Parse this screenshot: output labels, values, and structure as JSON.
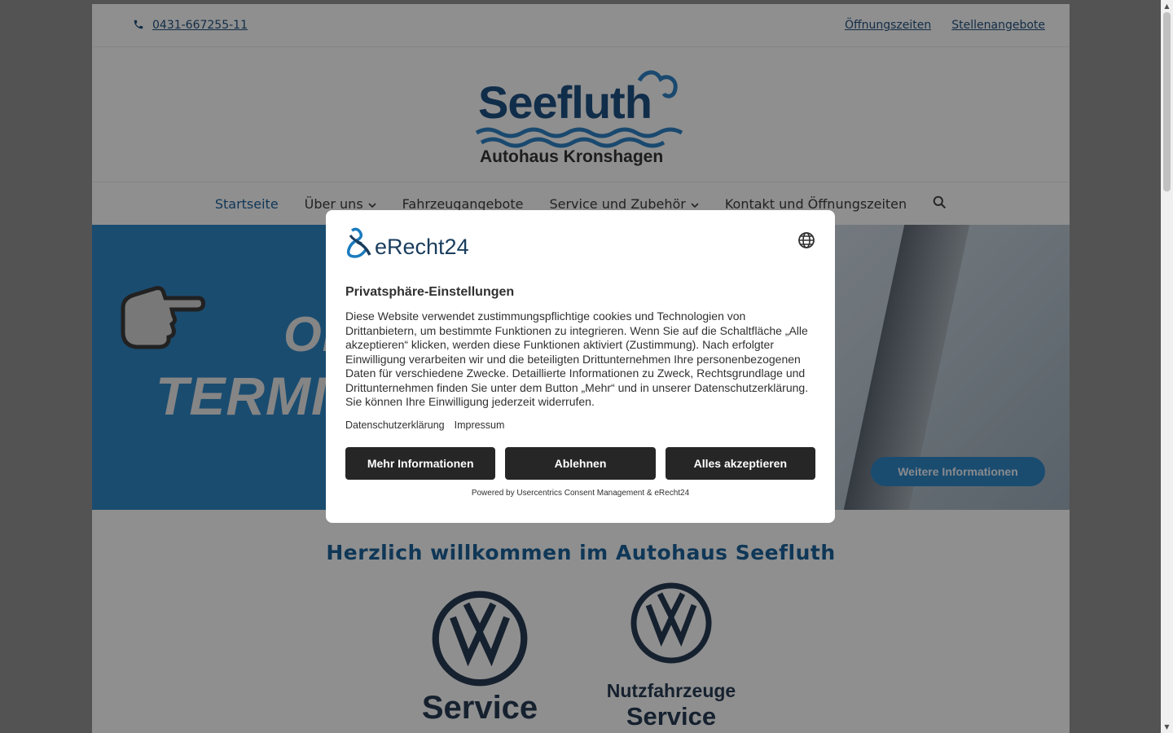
{
  "topbar": {
    "phone": "0431-667255-11",
    "links": [
      "Öffnungszeiten",
      "Stellenangebote"
    ]
  },
  "logo": {
    "name": "Seefluth",
    "subtitle": "Autohaus Kronshagen"
  },
  "nav": {
    "items": [
      {
        "label": "Startseite",
        "active": true,
        "dropdown": false
      },
      {
        "label": "Über uns",
        "active": false,
        "dropdown": true
      },
      {
        "label": "Fahrzeugangebote",
        "active": false,
        "dropdown": false
      },
      {
        "label": "Service und Zubehör",
        "active": false,
        "dropdown": true
      },
      {
        "label": "Kontakt und Öffnungszeiten",
        "active": false,
        "dropdown": false
      }
    ]
  },
  "hero": {
    "line1": "ON",
    "line2": "TERMINVE",
    "more_button": "Weitere Informationen"
  },
  "main": {
    "welcome": "Herzlich willkommen im Autohaus Seefluth",
    "brand1": "Service",
    "brand2_line1": "Nutzfahrzeuge",
    "brand2_line2": "Service"
  },
  "modal": {
    "brand": "eRecht24",
    "title": "Privatsphäre-Einstellungen",
    "body": "Diese Website verwendet zustimmungspflichtige cookies und Technologien von Drittanbietern, um bestimmte Funktionen zu integrieren. Wenn Sie auf die Schaltfläche „Alle akzeptieren“ klicken, werden diese Funktionen aktiviert (Zustimmung). Nach erfolgter Einwilligung verarbeiten wir und die beteiligten Drittunternehmen Ihre personenbezogenen Daten für verschiedene Zwecke. Detaillierte Informationen zu Zweck, Rechtsgrundlage und Drittunternehmen finden Sie unter dem Button „Mehr“ und in unserer Datenschutzerklärung. Sie können Ihre Einwilligung jederzeit widerrufen.",
    "links": [
      "Datenschutzerklärung",
      "Impressum"
    ],
    "buttons": {
      "more": "Mehr Informationen",
      "decline": "Ablehnen",
      "accept": "Alles akzeptieren"
    },
    "powered": "Powered by Usercentrics Consent Management & eRecht24"
  },
  "colors": {
    "accent": "#1b5f97",
    "hero_blue": "#2e83c2",
    "button_dark": "#262626"
  }
}
